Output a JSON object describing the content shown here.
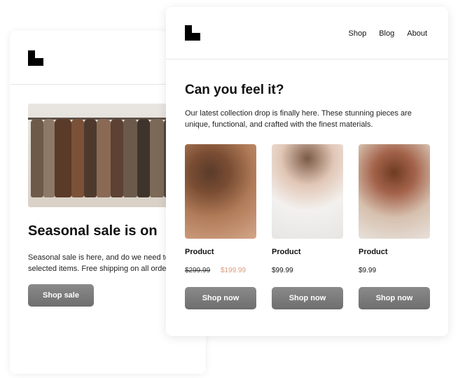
{
  "back_card": {
    "title": "Seasonal sale is on",
    "copy_line1": "Seasonal sale is here, and do we need to",
    "copy_line2": "selected items. Free shipping on all orde",
    "button": "Shop sale"
  },
  "front_card": {
    "nav": [
      {
        "label": "Shop"
      },
      {
        "label": "Blog"
      },
      {
        "label": "About"
      }
    ],
    "title": "Can you feel it?",
    "copy_line1": "Our latest collection drop is finally here. These stunning pieces are",
    "copy_line2": "unique, functional, and crafted with the finest materials.",
    "products": [
      {
        "name": "Product",
        "old_price": "$299.99",
        "price": "$199.99",
        "button": "Shop now"
      },
      {
        "name": "Product",
        "price": "$99.99",
        "button": "Shop now"
      },
      {
        "name": "Product",
        "price": "$9.99",
        "button": "Shop now"
      }
    ]
  },
  "colors": {
    "sale_price": "#d89a78",
    "button_bg": "#787878",
    "logo": "#000000"
  },
  "icons": [
    "brand-logo"
  ]
}
